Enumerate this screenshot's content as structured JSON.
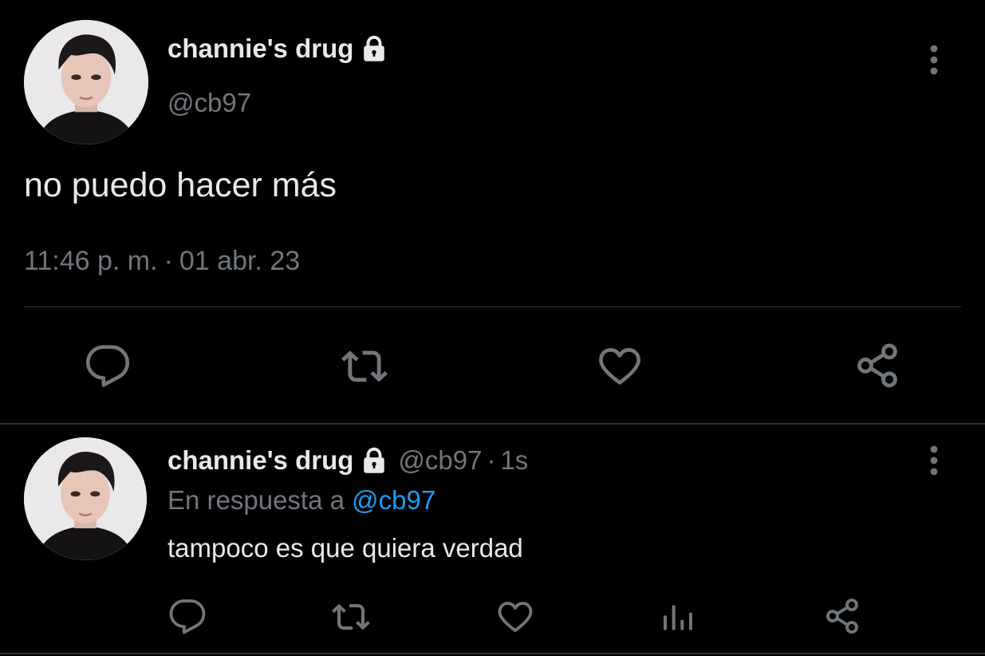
{
  "theme": {
    "background": "#000000",
    "text_primary": "#e7e9ea",
    "text_secondary": "#71767b",
    "link": "#1d9bf0",
    "divider": "#2f3336"
  },
  "main_tweet": {
    "display_name": "channie's drug",
    "protected_icon": "lock-icon",
    "handle": "@cb97",
    "text": "no puedo hacer más",
    "time": "11:46 p. m.",
    "separator": "·",
    "date": "01 abr. 23",
    "actions": [
      "reply-icon",
      "retweet-icon",
      "like-icon",
      "share-icon"
    ]
  },
  "reply_tweet": {
    "display_name": "channie's drug",
    "protected_icon": "lock-icon",
    "handle": "@cb97",
    "separator": "·",
    "relative_time": "1s",
    "in_reply_to_prefix": "En respuesta a",
    "in_reply_to_handle": "@cb97",
    "text": "tampoco es que quiera verdad",
    "actions": [
      "reply-icon",
      "retweet-icon",
      "like-icon",
      "views-icon",
      "share-icon"
    ]
  }
}
